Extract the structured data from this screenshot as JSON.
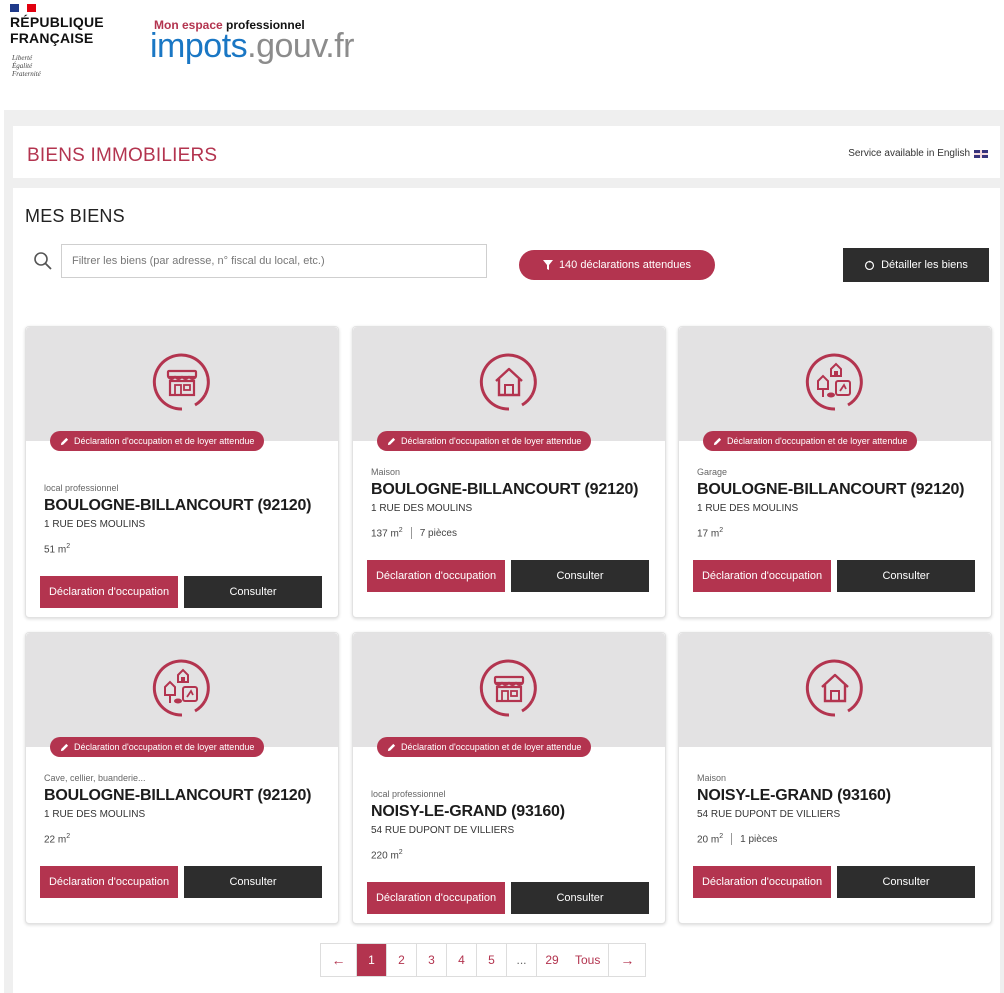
{
  "header": {
    "republic_line1": "RÉPUBLIQUE",
    "republic_line2": "FRANÇAISE",
    "motto_1": "Liberté",
    "motto_2": "Égalité",
    "motto_3": "Fraternité",
    "space_label_prefix": "Mon espace",
    "space_label_strong": "professionnel",
    "logo_part1": "impots",
    "logo_part2": ".gouv.fr"
  },
  "title_bar": {
    "title": "BIENS IMMOBILIERS",
    "language_link": "Service available in English"
  },
  "main": {
    "section_title": "MES BIENS",
    "search_placeholder": "Filtrer les biens (par adresse, n° fiscal du local, etc.)",
    "filter_label": "140 déclarations attendues",
    "detail_label": "Détailler les biens"
  },
  "cards": [
    {
      "icon": "shop-icon",
      "badge": "Déclaration d'occupation et de loyer attendue",
      "type": "local professionnel",
      "city": "BOULOGNE-BILLANCOURT (92120)",
      "address": "1 RUE DES MOULINS",
      "area_value": "51 m",
      "area_sup": "2",
      "rooms": "",
      "decl_label": "Déclaration d'occupation",
      "consult_label": "Consulter"
    },
    {
      "icon": "house-icon",
      "badge": "Déclaration d'occupation et de loyer attendue",
      "type": "Maison",
      "city": "BOULOGNE-BILLANCOURT (92120)",
      "address": "1 RUE DES MOULINS",
      "area_value": "137 m",
      "area_sup": "2",
      "rooms": "7 pièces",
      "decl_label": "Déclaration d'occupation",
      "consult_label": "Consulter"
    },
    {
      "icon": "outbuildings-icon",
      "badge": "Déclaration d'occupation et de loyer attendue",
      "type": "Garage",
      "city": "BOULOGNE-BILLANCOURT (92120)",
      "address": "1 RUE DES MOULINS",
      "area_value": "17 m",
      "area_sup": "2",
      "rooms": "",
      "decl_label": "Déclaration d'occupation",
      "consult_label": "Consulter"
    },
    {
      "icon": "outbuildings-icon",
      "badge": "Déclaration d'occupation et de loyer attendue",
      "type": "Cave, cellier, buanderie...",
      "city": "BOULOGNE-BILLANCOURT (92120)",
      "address": "1 RUE DES MOULINS",
      "area_value": "22 m",
      "area_sup": "2",
      "rooms": "",
      "decl_label": "Déclaration d'occupation",
      "consult_label": "Consulter"
    },
    {
      "icon": "shop-icon",
      "badge": "Déclaration d'occupation et de loyer attendue",
      "type": "local professionnel",
      "city": "NOISY-LE-GRAND (93160)",
      "address": "54 RUE DUPONT DE VILLIERS",
      "area_value": "220 m",
      "area_sup": "2",
      "rooms": "",
      "decl_label": "Déclaration d'occupation",
      "consult_label": "Consulter"
    },
    {
      "icon": "house-icon",
      "badge": "",
      "type": "Maison",
      "city": "NOISY-LE-GRAND (93160)",
      "address": "54 RUE DUPONT DE VILLIERS",
      "area_value": "20 m",
      "area_sup": "2",
      "rooms": "1 pièces",
      "decl_label": "Déclaration d'occupation",
      "consult_label": "Consulter"
    }
  ],
  "pagination": {
    "prev": "←",
    "pages": [
      "1",
      "2",
      "3",
      "4",
      "5",
      "...",
      "29"
    ],
    "current": "1",
    "all": "Tous",
    "next": "→"
  },
  "colors": {
    "brand": "#b3344f",
    "dark_button": "#2d2d2d",
    "card_top": "#e3e2e3",
    "logo_blue": "#1a77c4"
  }
}
